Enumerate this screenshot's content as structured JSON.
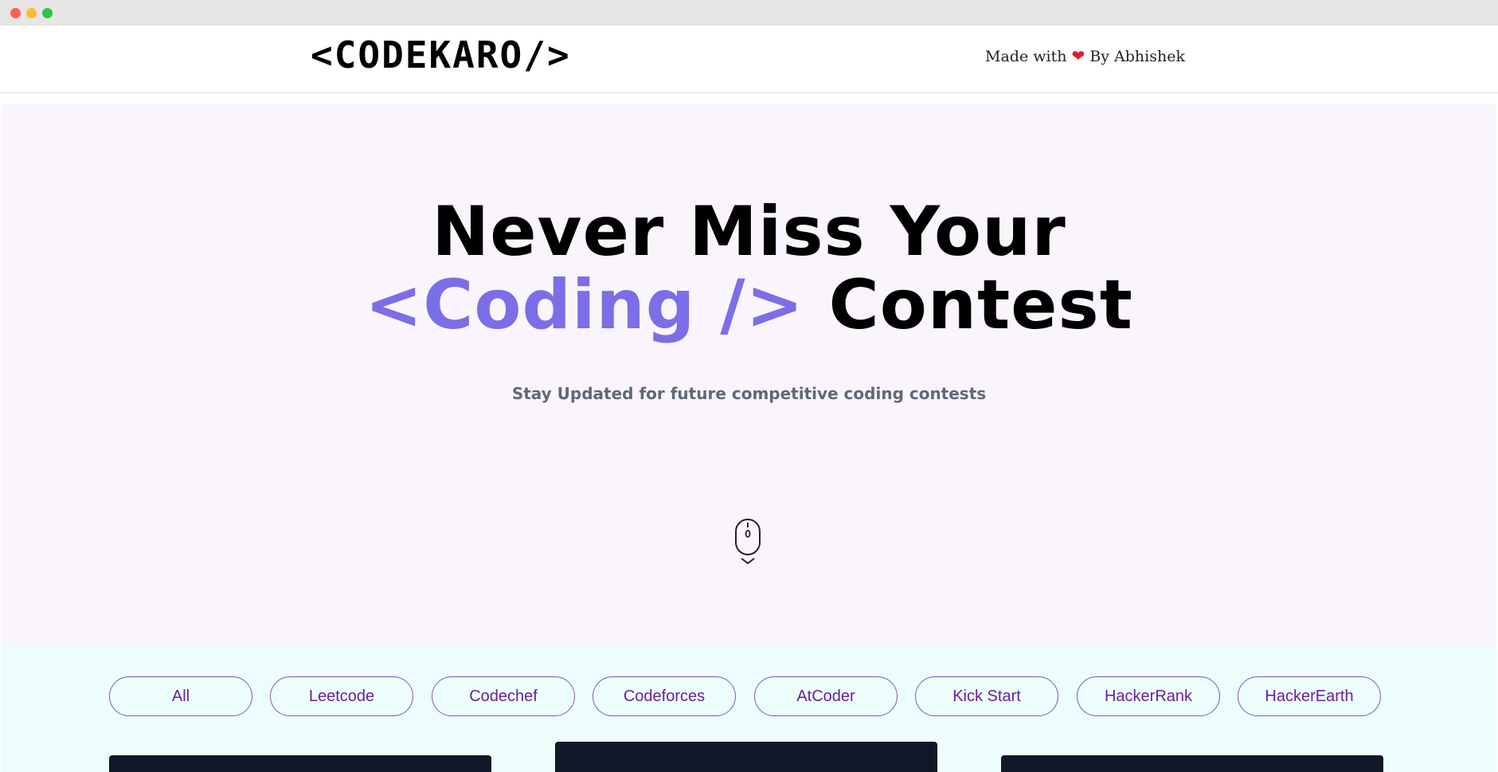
{
  "navbar": {
    "logo": "<CODEKARO/>",
    "credit_prefix": "Made with",
    "credit_suffix": "By Abhishek",
    "heart_icon": "heart-icon"
  },
  "hero": {
    "title_line1": "Never Miss Your",
    "title_accent": "<Coding />",
    "title_line2_rest": "Contest",
    "subtitle": "Stay Updated for future competitive coding contests",
    "scroll_icon": "mouse-scroll-icon"
  },
  "filters": [
    {
      "label": "All"
    },
    {
      "label": "Leetcode"
    },
    {
      "label": "Codechef"
    },
    {
      "label": "Codeforces"
    },
    {
      "label": "AtCoder"
    },
    {
      "label": "Kick Start"
    },
    {
      "label": "HackerRank"
    },
    {
      "label": "HackerEarth"
    }
  ],
  "colors": {
    "accent": "#7c6ee6",
    "hero_bg": "#faf5fd",
    "filter_bg": "#ecfdfc",
    "pill_text": "#6a1f9c",
    "card_bg": "#111827"
  }
}
